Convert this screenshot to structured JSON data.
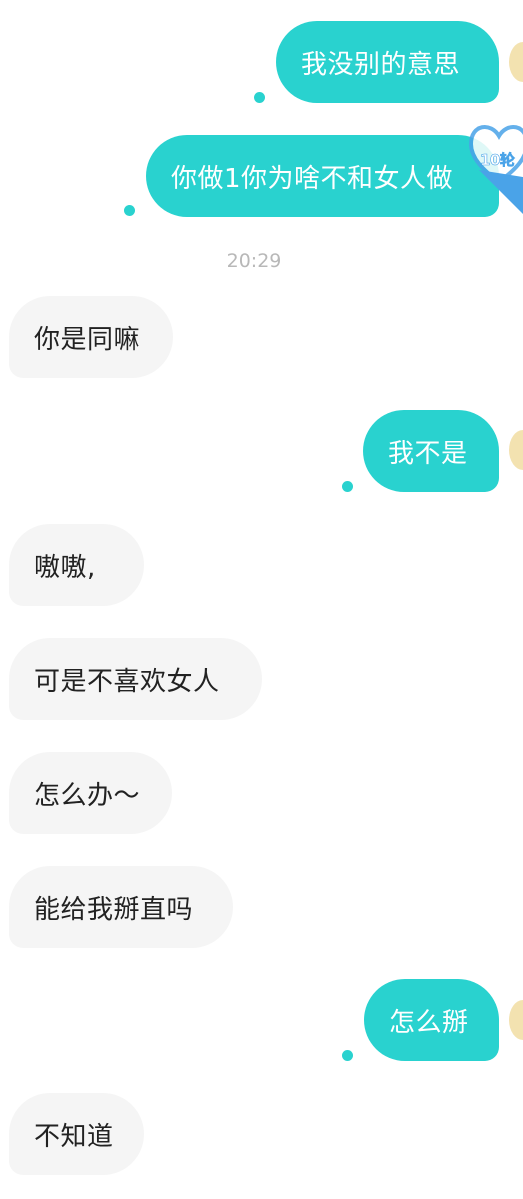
{
  "timestamp": "20:29",
  "streak_badge": "10轮",
  "colors": {
    "outgoing_bubble": "#29d2cf",
    "incoming_bubble": "#f5f5f5",
    "badge": "#4aa3e8"
  },
  "messages": [
    {
      "from": "me",
      "text": "我没别的意思"
    },
    {
      "from": "me",
      "text": "你做1你为啥不和女人做"
    },
    {
      "from": "them",
      "text": "你是同嘛"
    },
    {
      "from": "me",
      "text": "我不是"
    },
    {
      "from": "them",
      "text": "嗷嗷,"
    },
    {
      "from": "them",
      "text": "可是不喜欢女人"
    },
    {
      "from": "them",
      "text": "怎么办～"
    },
    {
      "from": "them",
      "text": "能给我掰直吗"
    },
    {
      "from": "me",
      "text": "怎么掰"
    },
    {
      "from": "them",
      "text": "不知道"
    }
  ]
}
